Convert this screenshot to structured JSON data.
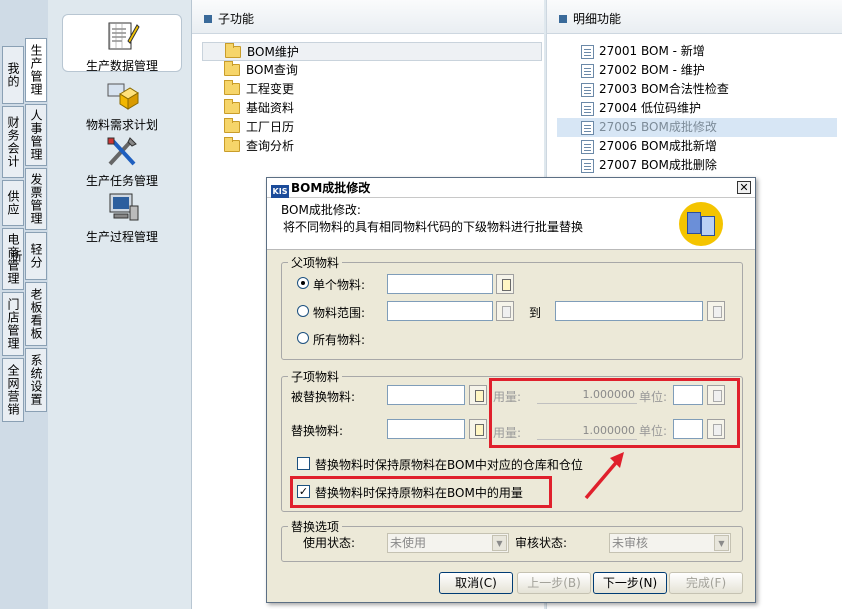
{
  "vtabs": {
    "col1": [
      "我的KIS",
      "财务会计",
      "供应链",
      "电商管理",
      "门店管理",
      "全网营销"
    ],
    "col2": [
      "生产管理",
      "人事管理",
      "发票管理",
      "轻分析",
      "老板看板",
      "系统设置"
    ]
  },
  "functions": [
    {
      "label": "生产数据管理",
      "icon": "production-data-icon"
    },
    {
      "label": "物料需求计划",
      "icon": "material-requirement-icon"
    },
    {
      "label": "生产任务管理",
      "icon": "production-task-icon"
    },
    {
      "label": "生产过程管理",
      "icon": "production-process-icon"
    }
  ],
  "sub_panel": {
    "header": "子功能",
    "items": [
      "BOM维护",
      "BOM查询",
      "工程变更",
      "基础资料",
      "工厂日历",
      "查询分析"
    ]
  },
  "detail_panel": {
    "header": "明细功能",
    "items": [
      {
        "code": "27001",
        "label": "BOM - 新增"
      },
      {
        "code": "27002",
        "label": "BOM - 维护"
      },
      {
        "code": "27003",
        "label": "BOM合法性检查"
      },
      {
        "code": "27004",
        "label": "低位码维护"
      },
      {
        "code": "27005",
        "label": "BOM成批修改"
      },
      {
        "code": "27006",
        "label": "BOM成批新增"
      },
      {
        "code": "27007",
        "label": "BOM成批删除"
      }
    ]
  },
  "dialog": {
    "logo": "KIS",
    "title": "BOM成批修改",
    "close": "✕",
    "desc1": "BOM成批修改:",
    "desc2": "将不同物料的具有相同物料代码的下级物料进行批量替换",
    "parent": {
      "legend": "父项物料",
      "single": "单个物料:",
      "range": "物料范围:",
      "to": "到",
      "all": "所有物料:"
    },
    "child": {
      "legend": "子项物料",
      "replaced": "被替换物料:",
      "replacement": "替换物料:",
      "qty_label": "用量:",
      "qty1": "1.000000",
      "qty2": "1.000000",
      "unit_label": "单位:",
      "keep_loc": "替换物料时保持原物料在BOM中对应的仓库和仓位",
      "keep_qty": "替换物料时保持原物料在BOM中的用量"
    },
    "options": {
      "legend": "替换选项",
      "use_status": "使用状态:",
      "use_value": "未使用",
      "audit_status": "审核状态:",
      "audit_value": "未审核"
    },
    "buttons": {
      "cancel": "取消(C)",
      "prev": "上一步(B)",
      "next": "下一步(N)",
      "finish": "完成(F)"
    }
  },
  "colors": {
    "annotation": "#e0202c",
    "selection": "#d7e6f5"
  }
}
